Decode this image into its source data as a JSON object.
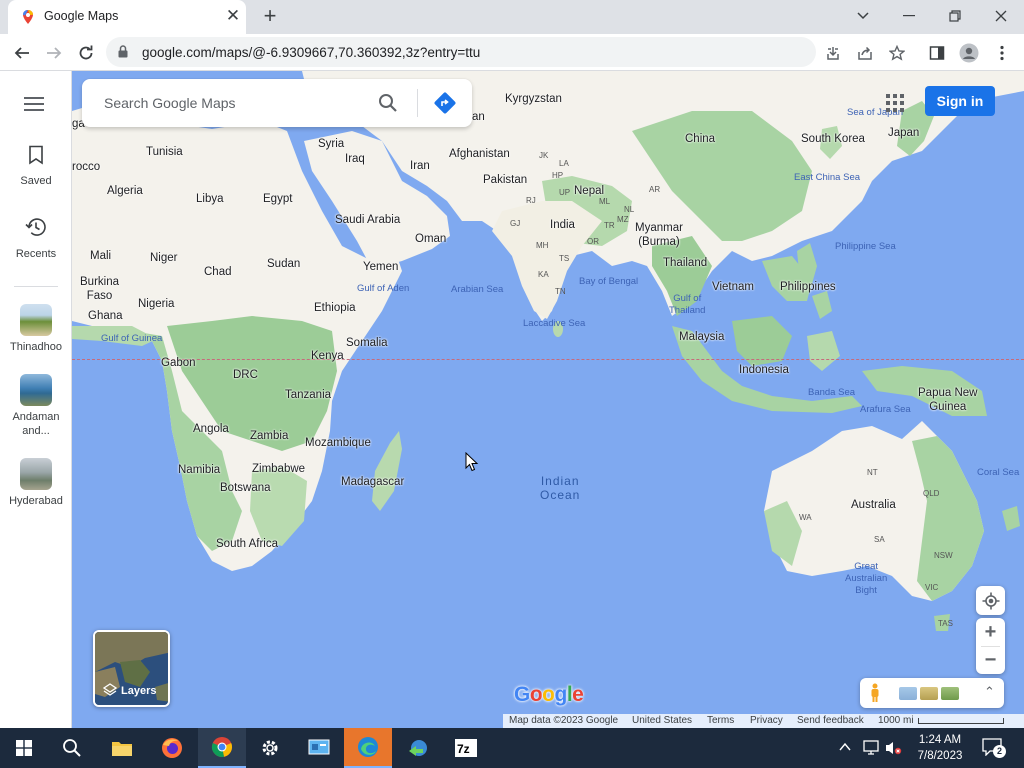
{
  "browser": {
    "tab_title": "Google Maps",
    "url": "google.com/maps/@-6.9309667,70.360392,3z?entry=ttu"
  },
  "rail": {
    "saved": "Saved",
    "recents": "Recents",
    "places": [
      {
        "label": "Thinadhoo"
      },
      {
        "label": "Andaman\nand..."
      },
      {
        "label": "Hyderabad"
      }
    ]
  },
  "search": {
    "placeholder": "Search Google Maps"
  },
  "signin": "Sign in",
  "layers_label": "Layers",
  "zoom": {
    "in": "+",
    "out": "−"
  },
  "google_logo": "Google",
  "attribution": {
    "map_data": "Map data ©2023 Google",
    "region": "United States",
    "terms": "Terms",
    "privacy": "Privacy",
    "feedback": "Send feedback",
    "scale": "1000 mi"
  },
  "map_labels": {
    "countries": [
      "Kyrgyzstan",
      "China",
      "Japan",
      "South Korea",
      "Tunisia",
      "Syria",
      "Iraq",
      "Iran",
      "Afghanistan",
      "Pakistan",
      "Nepal",
      "Algeria",
      "Libya",
      "Egypt",
      "Saudi Arabia",
      "Oman",
      "India",
      "Myanmar\n(Burma)",
      "Mali",
      "Niger",
      "Chad",
      "Sudan",
      "Yemen",
      "Thailand",
      "Burkina\nFaso",
      "Nigeria",
      "Ethiopia",
      "Vietnam",
      "Philippines",
      "Ghana",
      "Malaysia",
      "Somalia",
      "Gabon",
      "Kenya",
      "DRC",
      "Indonesia",
      "Papua New\nGuinea",
      "Tanzania",
      "Angola",
      "Zambia",
      "Mozambique",
      "Namibia",
      "Zimbabwe",
      "Madagascar",
      "Botswana",
      "South Africa",
      "Australia",
      "rocco",
      "ga",
      "Ga",
      "an"
    ],
    "seas": [
      "Sea of Japan",
      "East China Sea",
      "Philippine Sea",
      "Gulf of Aden",
      "Arabian Sea",
      "Bay of Bengal",
      "Gulf of\nThailand",
      "Laccadive Sea",
      "Gulf of Guinea",
      "Banda Sea",
      "Arafura Sea",
      "Coral Sea"
    ],
    "ocean": "Indian\nOcean",
    "states": [
      "JK",
      "LA",
      "HP",
      "UP",
      "RJ",
      "GJ",
      "MH",
      "OR",
      "TS",
      "KA",
      "TN",
      "AR",
      "NL",
      "ML",
      "MZ",
      "TR",
      "NT",
      "QLD",
      "WA",
      "SA",
      "NSW",
      "VIC",
      "TAS",
      "Great\nAustralian\nBight"
    ]
  },
  "taskbar": {
    "time": "1:24 AM",
    "date": "7/8/2023",
    "notifications": "2"
  }
}
